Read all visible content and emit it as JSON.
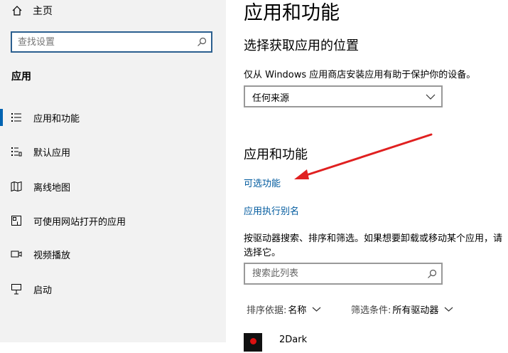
{
  "sidebar": {
    "home_label": "主页",
    "search_placeholder": "查找设置",
    "section_title": "应用",
    "items": [
      {
        "label": "应用和功能",
        "icon": "apps-features-icon",
        "selected": true
      },
      {
        "label": "默认应用",
        "icon": "default-apps-icon"
      },
      {
        "label": "离线地图",
        "icon": "offline-maps-icon"
      },
      {
        "label": "可使用网站打开的应用",
        "icon": "apps-for-websites-icon"
      },
      {
        "label": "视频播放",
        "icon": "video-playback-icon"
      },
      {
        "label": "启动",
        "icon": "startup-icon"
      }
    ]
  },
  "main": {
    "page_title": "应用和功能",
    "choose_location": {
      "heading": "选择获取应用的位置",
      "description": "仅从 Windows 应用商店安装应用有助于保护你的设备。",
      "dropdown_value": "任何来源"
    },
    "apps_features": {
      "heading": "应用和功能",
      "link_optional": "可选功能",
      "link_alias": "应用执行别名",
      "instructions": "按驱动器搜索、排序和筛选。如果想要卸载或移动某个应用，请选择它。",
      "search_placeholder": "搜索此列表",
      "sort_label": "排序依据:",
      "sort_value": "名称",
      "filter_label": "筛选条件:",
      "filter_value": "所有驱动器",
      "apps": [
        {
          "name": "2Dark"
        }
      ]
    }
  },
  "colors": {
    "accent": "#0063b1",
    "link": "#005a9e",
    "annotation_arrow": "#e02020",
    "sidebar_bg": "#f2f2f2"
  }
}
